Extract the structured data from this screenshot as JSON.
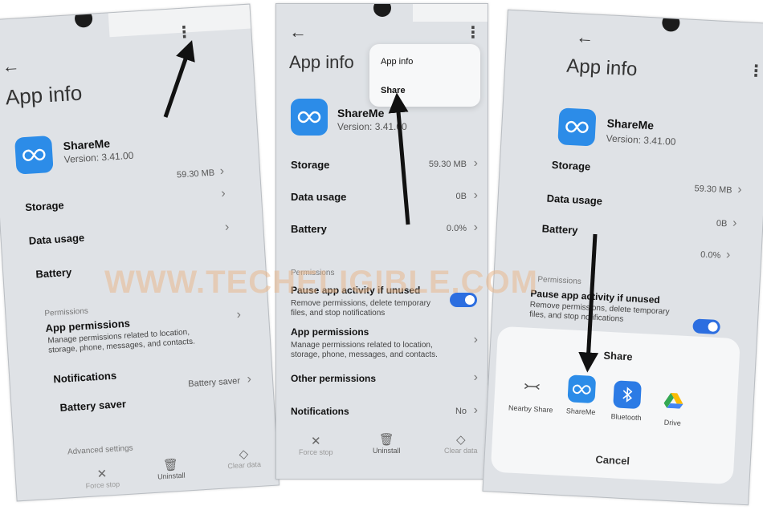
{
  "panel1": {
    "title": "App info",
    "app_name": "ShareMe",
    "app_version": "Version: 3.41.00",
    "storage_size": "59.30 MB",
    "rows": {
      "storage": "Storage",
      "data_usage": "Data usage",
      "battery": "Battery"
    },
    "permissions_section": "Permissions",
    "app_permissions": "App permissions",
    "app_permissions_desc": "Manage permissions related to location, storage, phone, messages, and contacts.",
    "notifications": "Notifications",
    "battery_saver": "Battery saver",
    "battery_saver_value": "Battery saver",
    "advanced_settings": "Advanced settings",
    "bottom": {
      "force_stop": "Force stop",
      "uninstall": "Uninstall",
      "clear_data": "Clear data"
    }
  },
  "panel2": {
    "title": "App info",
    "menu": {
      "app_info": "App info",
      "share": "Share"
    },
    "app_name": "ShareMe",
    "app_version": "Version: 3.41.00",
    "rows": {
      "storage": "Storage",
      "storage_value": "59.30 MB",
      "data_usage": "Data usage",
      "data_usage_value": "0B",
      "battery": "Battery",
      "battery_value": "0.0%"
    },
    "permissions_section": "Permissions",
    "pause_title": "Pause app activity if unused",
    "pause_desc": "Remove permissions, delete temporary files, and stop notifications",
    "app_permissions": "App permissions",
    "app_permissions_desc": "Manage permissions related to location, storage, phone, messages, and contacts.",
    "other_permissions": "Other permissions",
    "notifications": "Notifications",
    "notifications_value": "No",
    "bottom": {
      "force_stop": "Force stop",
      "uninstall": "Uninstall",
      "clear_data": "Clear data"
    }
  },
  "panel3": {
    "title": "App info",
    "app_name": "ShareMe",
    "app_version": "Version: 3.41.00",
    "rows": {
      "storage": "Storage",
      "storage_value": "59.30 MB",
      "data_usage": "Data usage",
      "data_usage_value": "0B",
      "battery": "Battery",
      "battery_value": "0.0%"
    },
    "permissions_section": "Permissions",
    "pause_title": "Pause app activity if unused",
    "pause_desc": "Remove permissions, delete temporary files, and stop notifications",
    "share_sheet": {
      "title": "Share",
      "targets": [
        "Nearby Share",
        "ShareMe",
        "Bluetooth",
        "Drive"
      ],
      "cancel": "Cancel"
    }
  },
  "watermark": "WWW.TECHELIGIBLE.COM",
  "colors": {
    "accent": "#2c8ce8",
    "toggle": "#2c6ee0",
    "panel_bg": "#dfe2e6",
    "arrow": "#111111"
  }
}
